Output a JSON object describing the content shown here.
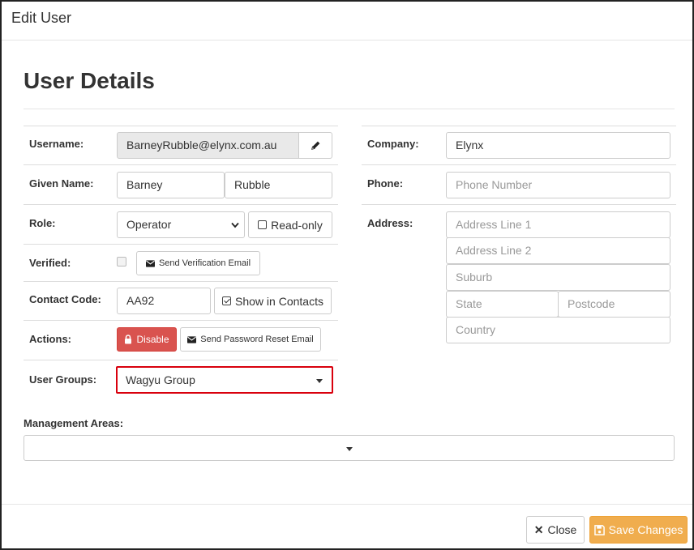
{
  "modal": {
    "title": "Edit User"
  },
  "page": {
    "title": "User Details"
  },
  "left": {
    "username": {
      "label": "Username:",
      "value": "BarneyRubble@elynx.com.au",
      "edit_icon": "pencil-icon"
    },
    "given_name": {
      "label": "Given Name:",
      "first": "Barney",
      "last": "Rubble"
    },
    "role": {
      "label": "Role:",
      "selected": "Operator",
      "readonly_label": "Read-only"
    },
    "verified": {
      "label": "Verified:",
      "send_button": "Send Verification Email",
      "icon": "envelope-icon"
    },
    "contact_code": {
      "label": "Contact Code:",
      "value": "AA92",
      "show_label": "Show in Contacts"
    },
    "actions": {
      "label": "Actions:",
      "disable": "Disable",
      "reset": "Send Password Reset Email"
    },
    "user_groups": {
      "label": "User Groups:",
      "selected": "Wagyu Group",
      "highlight_color": "#d9000d"
    }
  },
  "right": {
    "company": {
      "label": "Company:",
      "value": "Elynx"
    },
    "phone": {
      "label": "Phone:",
      "placeholder": "Phone Number"
    },
    "address": {
      "label": "Address:",
      "line1": "Address Line 1",
      "line2": "Address Line 2",
      "suburb": "Suburb",
      "state": "State",
      "postcode": "Postcode",
      "country": "Country"
    }
  },
  "management_areas": {
    "label": "Management Areas:",
    "selected": ""
  },
  "footer": {
    "close": "Close",
    "save": "Save Changes"
  },
  "colors": {
    "danger": "#d9534f",
    "warning": "#f0ad4e",
    "highlight": "#d9000d"
  }
}
